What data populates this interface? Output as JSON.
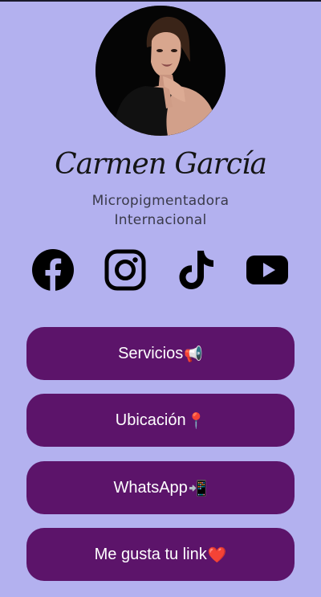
{
  "profile": {
    "name": "Carmen García",
    "subtitle_line1": "Micropigmentadora",
    "subtitle_line2": "Internacional"
  },
  "social": [
    {
      "icon": "facebook-icon"
    },
    {
      "icon": "instagram-icon"
    },
    {
      "icon": "tiktok-icon"
    },
    {
      "icon": "youtube-icon"
    }
  ],
  "links": [
    {
      "label": "Servicios",
      "emoji": "📢"
    },
    {
      "label": "Ubicación",
      "emoji": "📍"
    },
    {
      "label": "WhatsApp",
      "emoji": "📲"
    },
    {
      "label": "Me gusta tu link",
      "emoji": "❤️"
    }
  ],
  "colors": {
    "background": "#b3b1ef",
    "button": "#5c146a",
    "button_text": "#ffffff"
  }
}
